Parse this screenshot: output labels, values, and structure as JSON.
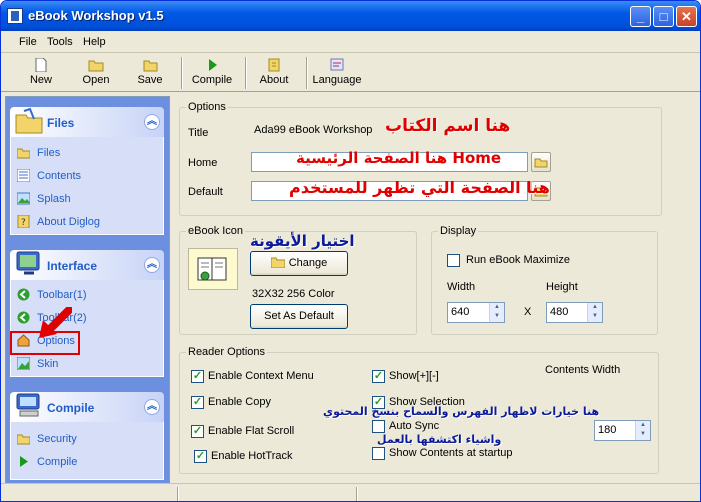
{
  "window": {
    "title": "eBook Workshop v1.5",
    "min": "_",
    "max": "□",
    "close": "✕"
  },
  "menu": [
    "File",
    "Tools",
    "Help"
  ],
  "toolbar": [
    "New",
    "Open",
    "Save",
    "Compile",
    "About",
    "Language"
  ],
  "sidebar": {
    "files": {
      "title": "Files",
      "items": [
        "Files",
        "Contents",
        "Splash",
        "About Diglog"
      ]
    },
    "interface": {
      "title": "Interface",
      "items": [
        "Toolbar(1)",
        "Toolbar(2)",
        "Options",
        "Skin"
      ]
    },
    "compile": {
      "title": "Compile",
      "items": [
        "Security",
        "Compile"
      ]
    }
  },
  "options": {
    "legend": "Options",
    "title_label": "Title",
    "title_value": "Ada99 eBook Workshop",
    "home_label": "Home",
    "home_value": "",
    "default_label": "Default",
    "default_value": ""
  },
  "ebook_icon": {
    "legend": "eBook Icon",
    "change": "Change",
    "size": "32X32 256 Color",
    "set_default": "Set As Default"
  },
  "display": {
    "legend": "Display",
    "run_max": "Run eBook Maximize",
    "width_label": "Width",
    "width_value": "640",
    "x_label": "X",
    "height_label": "Height",
    "height_value": "480"
  },
  "reader": {
    "legend": "Reader Options",
    "context_menu": "Enable Context Menu",
    "copy": "Enable Copy",
    "flat_scroll": "Enable Flat Scroll",
    "hottrack": "Enable HotTrack",
    "show_pm": "Show[+][-]",
    "show_selection": "Show Selection",
    "auto_sync": "Auto Sync",
    "show_contents": "Show Contents at startup",
    "contents_width_label": "Contents Width",
    "contents_width_value": "180"
  },
  "annotations": {
    "book_name": "هنا اسم الكتاب",
    "home_page": "هنا الصفحة الرئيسية Home",
    "user_page": "هنا الصفحة التي تظهر للمستخدم",
    "choose_icon": "اختيار الأيقونة",
    "reader_note_1": "هنا خيارات لاظهار الفهرس والسماح بنسخ المحتوي",
    "reader_note_2": "واشياء اكتشفها بالعمل"
  },
  "colors": {
    "accent": "#215dc6",
    "titlebar": "#0058e6",
    "highlight": "#e00000"
  }
}
